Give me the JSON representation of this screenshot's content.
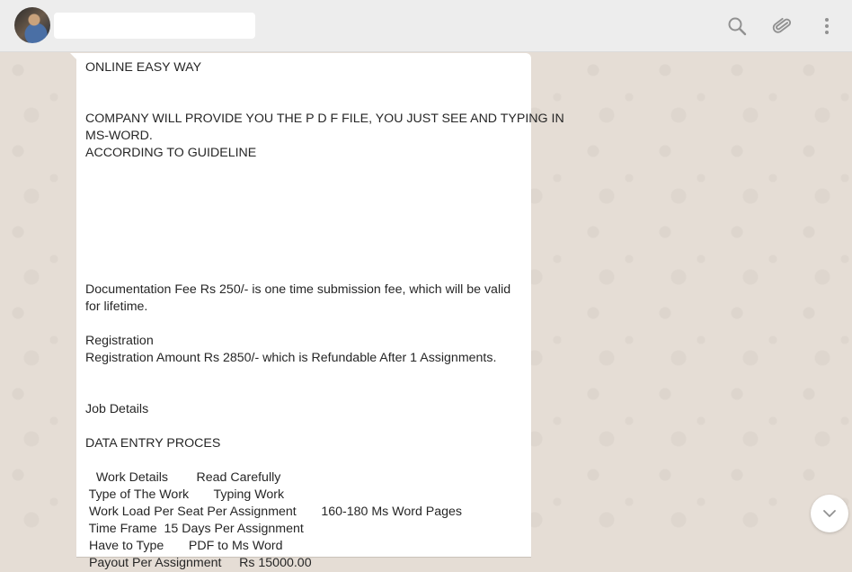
{
  "header": {
    "contact_name": "",
    "icons": [
      "search-icon",
      "attach-icon",
      "menu-icon"
    ]
  },
  "message": {
    "lines": [
      "ONLINE EASY WAY",
      "",
      "",
      "COMPANY WILL PROVIDE YOU THE P D F FILE, YOU JUST SEE AND TYPING IN",
      "MS-WORD.",
      "ACCORDING TO GUIDELINE",
      "",
      "",
      "",
      "",
      "",
      "",
      "",
      "Documentation Fee Rs 250/- is one time submission fee, which will be valid",
      "for lifetime.",
      "",
      "Registration",
      "Registration Amount Rs 2850/- which is Refundable After 1 Assignments.",
      "",
      "",
      "Job Details",
      "",
      "DATA ENTRY PROCES",
      "",
      "   Work Details        Read Carefully",
      " Type of The Work       Typing Work",
      " Work Load Per Seat Per Assignment       160-180 Ms Word Pages",
      " Time Frame  15 Days Per Assignment",
      " Have to Type       PDF to Ms Word",
      " Payout Per Assignment     Rs 15000.00"
    ]
  },
  "colors": {
    "header_bg": "#ededed",
    "wallpaper": "#e5ddd5",
    "bubble": "#ffffff",
    "icon": "#919191"
  }
}
